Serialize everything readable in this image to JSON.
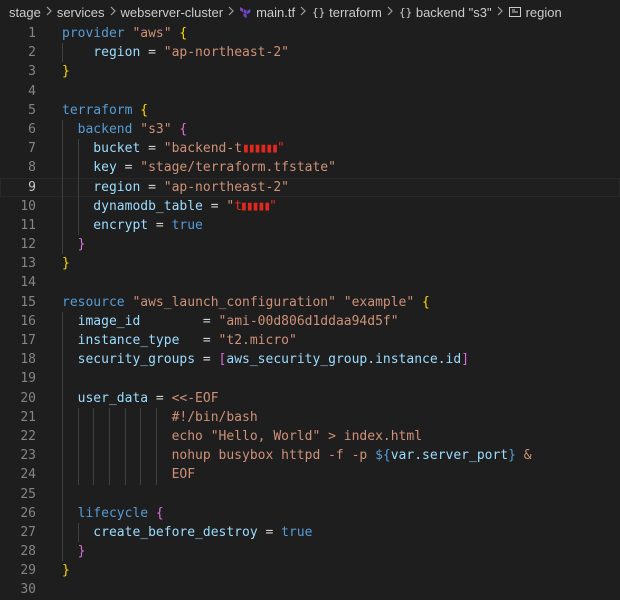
{
  "breadcrumb": {
    "items": [
      "stage",
      "services",
      "webserver-cluster",
      "main.tf",
      "terraform",
      "backend \"s3\"",
      "region"
    ]
  },
  "editor": {
    "language": "terraform",
    "active_line": 9,
    "colors": {
      "keyword": "#569cd6",
      "string": "#ce9178",
      "text": "#9cdcfe",
      "bracket1": "#ffd700",
      "bracket2": "#da70d6",
      "bracket3": "#179fff",
      "number": "#b5cea8"
    },
    "lines": [
      {
        "n": 1,
        "tokens": [
          [
            "provider ",
            "k"
          ],
          [
            "\"aws\"",
            "s"
          ],
          [
            " ",
            ""
          ],
          [
            "{",
            "b1"
          ]
        ]
      },
      {
        "n": 2,
        "tokens": [
          [
            "    region ",
            "t"
          ],
          [
            "= ",
            ""
          ],
          [
            "\"ap-northeast-2\"",
            "s"
          ]
        ]
      },
      {
        "n": 3,
        "tokens": [
          [
            "}",
            "b1"
          ]
        ]
      },
      {
        "n": 4,
        "tokens": []
      },
      {
        "n": 5,
        "tokens": [
          [
            "terraform ",
            "k"
          ],
          [
            "{",
            "b1"
          ]
        ]
      },
      {
        "n": 6,
        "tokens": [
          [
            "  backend ",
            "k"
          ],
          [
            "\"s3\"",
            "s"
          ],
          [
            " ",
            ""
          ],
          [
            "{",
            "b2"
          ]
        ]
      },
      {
        "n": 7,
        "tokens": [
          [
            "    bucket ",
            "t"
          ],
          [
            "= ",
            ""
          ],
          [
            "\"backend-t",
            "s"
          ],
          [
            "▮▮▮▮▮▮\"",
            "red"
          ]
        ]
      },
      {
        "n": 8,
        "tokens": [
          [
            "    key ",
            "t"
          ],
          [
            "= ",
            ""
          ],
          [
            "\"stage/terraform.tfstate\"",
            "s"
          ]
        ]
      },
      {
        "n": 9,
        "tokens": [
          [
            "    region ",
            "t"
          ],
          [
            "= ",
            ""
          ],
          [
            "\"ap-northeast-2\"",
            "s"
          ]
        ]
      },
      {
        "n": 10,
        "tokens": [
          [
            "    dynamodb_table ",
            "t"
          ],
          [
            "= ",
            ""
          ],
          [
            "\"",
            "s"
          ],
          [
            "t▮▮▮▮▮\"",
            "red"
          ]
        ]
      },
      {
        "n": 11,
        "tokens": [
          [
            "    encrypt ",
            "t"
          ],
          [
            "= ",
            ""
          ],
          [
            "true",
            "k"
          ]
        ]
      },
      {
        "n": 12,
        "tokens": [
          [
            "  }",
            "b2"
          ]
        ]
      },
      {
        "n": 13,
        "tokens": [
          [
            "}",
            "b1"
          ]
        ]
      },
      {
        "n": 14,
        "tokens": []
      },
      {
        "n": 15,
        "tokens": [
          [
            "resource ",
            "k"
          ],
          [
            "\"aws_launch_configuration\" \"example\"",
            "s"
          ],
          [
            " ",
            ""
          ],
          [
            "{",
            "b1"
          ]
        ]
      },
      {
        "n": 16,
        "tokens": [
          [
            "  image_id        ",
            "t"
          ],
          [
            "= ",
            ""
          ],
          [
            "\"ami-00d806d1ddaa94d5f\"",
            "s"
          ]
        ]
      },
      {
        "n": 17,
        "tokens": [
          [
            "  instance_type   ",
            "t"
          ],
          [
            "= ",
            ""
          ],
          [
            "\"t2.micro\"",
            "s"
          ]
        ]
      },
      {
        "n": 18,
        "tokens": [
          [
            "  security_groups ",
            "t"
          ],
          [
            "= ",
            ""
          ],
          [
            "[",
            "b2"
          ],
          [
            "aws_security_group.instance.id",
            "t"
          ],
          [
            "]",
            "b2"
          ]
        ]
      },
      {
        "n": 19,
        "tokens": []
      },
      {
        "n": 20,
        "tokens": [
          [
            "  user_data ",
            "t"
          ],
          [
            "= ",
            ""
          ],
          [
            "<<-EOF",
            "s"
          ]
        ]
      },
      {
        "n": 21,
        "tokens": [
          [
            "              #!/bin/bash",
            "s"
          ]
        ]
      },
      {
        "n": 22,
        "tokens": [
          [
            "              echo \"Hello, World\" > index.html",
            "s"
          ]
        ]
      },
      {
        "n": 23,
        "tokens": [
          [
            "              nohup busybox httpd -f -p ",
            "s"
          ],
          [
            "${",
            "k"
          ],
          [
            "var.server_port",
            "t"
          ],
          [
            "}",
            "k"
          ],
          [
            " &",
            "s"
          ]
        ]
      },
      {
        "n": 24,
        "tokens": [
          [
            "              EOF",
            "s"
          ]
        ]
      },
      {
        "n": 25,
        "tokens": []
      },
      {
        "n": 26,
        "tokens": [
          [
            "  lifecycle ",
            "k"
          ],
          [
            "{",
            "b2"
          ]
        ]
      },
      {
        "n": 27,
        "tokens": [
          [
            "    create_before_destroy ",
            "t"
          ],
          [
            "= ",
            ""
          ],
          [
            "true",
            "k"
          ]
        ]
      },
      {
        "n": 28,
        "tokens": [
          [
            "  }",
            "b2"
          ]
        ]
      },
      {
        "n": 29,
        "tokens": [
          [
            "}",
            "b1"
          ]
        ]
      },
      {
        "n": 30,
        "tokens": []
      }
    ]
  }
}
